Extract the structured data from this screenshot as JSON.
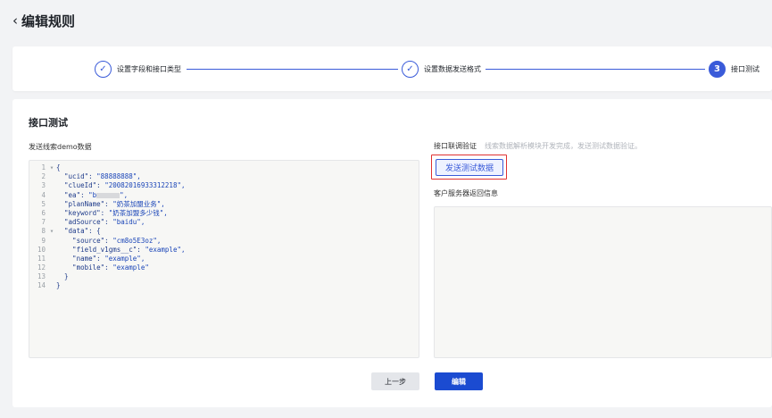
{
  "header": {
    "back_icon": "‹",
    "title": "编辑规则"
  },
  "steps": [
    {
      "number": "✓",
      "label": "设置字段和接口类型",
      "state": "done"
    },
    {
      "number": "✓",
      "label": "设置数据发送格式",
      "state": "done"
    },
    {
      "number": "3",
      "label": "接口测试",
      "state": "active"
    }
  ],
  "main": {
    "section_title": "接口测试",
    "left_label": "发送线索demo数据",
    "code_lines": [
      {
        "ln": "1",
        "fold": "▾",
        "text": "{"
      },
      {
        "ln": "2",
        "fold": "",
        "key": "  \"ucid\": ",
        "val": "\"88888888\","
      },
      {
        "ln": "3",
        "fold": "",
        "key": "  \"clueId\": ",
        "val": "\"20082016933312218\","
      },
      {
        "ln": "4",
        "fold": "",
        "key": "  \"ea\": ",
        "val": "\"b",
        "redacted": true,
        "tail": "\","
      },
      {
        "ln": "5",
        "fold": "",
        "key": "  \"planName\": ",
        "val": "\"奶茶加盟业务\","
      },
      {
        "ln": "6",
        "fold": "",
        "key": "  \"keyword\": ",
        "val": "\"奶茶加盟多少钱\","
      },
      {
        "ln": "7",
        "fold": "",
        "key": "  \"adSource\": ",
        "val": "\"baidu\","
      },
      {
        "ln": "8",
        "fold": "▾",
        "text": "  \"data\": {"
      },
      {
        "ln": "9",
        "fold": "",
        "key": "    \"source\": ",
        "val": "\"cm8o5E3oz\","
      },
      {
        "ln": "10",
        "fold": "",
        "key": "    \"field_v1gms__c\": ",
        "val": "\"example\","
      },
      {
        "ln": "11",
        "fold": "",
        "key": "    \"name\": ",
        "val": "\"example\","
      },
      {
        "ln": "12",
        "fold": "",
        "key": "    \"mobile\": ",
        "val": "\"example\""
      },
      {
        "ln": "13",
        "fold": "",
        "text": "  }"
      },
      {
        "ln": "14",
        "fold": "",
        "text": "}"
      }
    ],
    "right_label": "接口联调验证",
    "right_hint": "线索数据解析模块开发完成，发送测试数据验证。",
    "send_button": "发送测试数据",
    "response_label": "客户服务器返回信息",
    "prev_button": "上一步",
    "edit_button": "编辑"
  },
  "colors": {
    "accent": "#3a5bd9",
    "primary_button": "#1b4bd1",
    "highlight": "#e03131"
  }
}
